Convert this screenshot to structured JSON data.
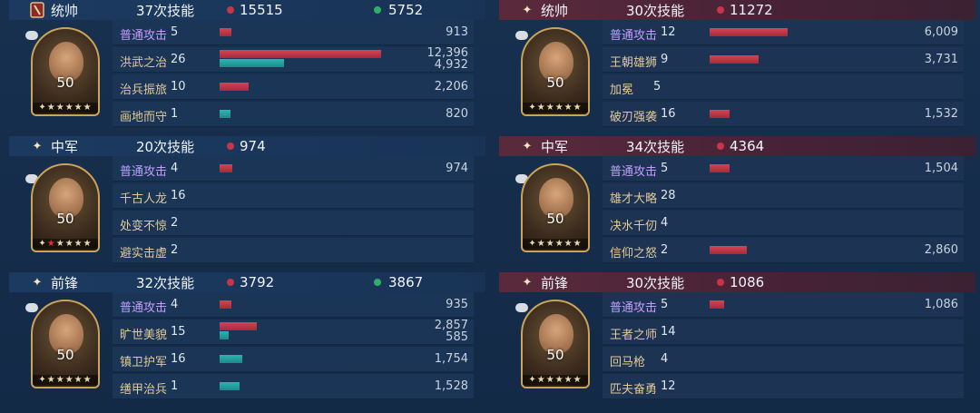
{
  "colors": {
    "accent_red": "#c8344a",
    "accent_green": "#2fae6a",
    "skill_gold": "#e2c99a",
    "skill_purple": "#c69cff"
  },
  "left": [
    {
      "role": "统帅",
      "count": "37次技能",
      "red": "15515",
      "green": "5752",
      "badge": "crest-icon",
      "level": "50",
      "stars": "✦★★★★★",
      "skills": [
        {
          "name": "普通攻击",
          "lv": "5",
          "basic": true,
          "bars": [
            {
              "c": "red",
              "v": 913
            }
          ],
          "vals": [
            "913"
          ]
        },
        {
          "name": "洪武之治",
          "lv": "26",
          "bars": [
            {
              "c": "red",
              "v": 12396
            },
            {
              "c": "teal",
              "v": 4932
            }
          ],
          "vals": [
            "12,396",
            "4,932"
          ]
        },
        {
          "name": "治兵振旅",
          "lv": "10",
          "bars": [
            {
              "c": "red",
              "v": 2206
            }
          ],
          "vals": [
            "2,206"
          ]
        },
        {
          "name": "画地而守",
          "lv": "1",
          "bars": [
            {
              "c": "teal",
              "v": 820
            }
          ],
          "vals": [
            "820"
          ]
        }
      ]
    },
    {
      "role": "中军",
      "count": "20次技能",
      "red": "974",
      "green": "",
      "badge": "✦",
      "level": "50",
      "stars": "✦",
      "stars_red": "★",
      "stars_tail": "★★★★",
      "skills": [
        {
          "name": "普通攻击",
          "lv": "4",
          "basic": true,
          "bars": [
            {
              "c": "red",
              "v": 974
            }
          ],
          "vals": [
            "974"
          ]
        },
        {
          "name": "千古人龙",
          "lv": "16",
          "bars": [],
          "vals": []
        },
        {
          "name": "处变不惊",
          "lv": "2",
          "bars": [],
          "vals": []
        },
        {
          "name": "避实击虚",
          "lv": "2",
          "bars": [],
          "vals": []
        }
      ]
    },
    {
      "role": "前锋",
      "count": "32次技能",
      "red": "3792",
      "green": "3867",
      "badge": "✦",
      "level": "50",
      "stars": "✦★★★★★",
      "skills": [
        {
          "name": "普通攻击",
          "lv": "4",
          "basic": true,
          "bars": [
            {
              "c": "red",
              "v": 935
            }
          ],
          "vals": [
            "935"
          ]
        },
        {
          "name": "旷世美貌",
          "lv": "15",
          "bars": [
            {
              "c": "red",
              "v": 2857
            },
            {
              "c": "teal",
              "v": 585
            }
          ],
          "vals": [
            "2,857",
            "585"
          ]
        },
        {
          "name": "镇卫护军",
          "lv": "16",
          "bars": [
            {
              "c": "teal",
              "v": 1754
            }
          ],
          "vals": [
            "1,754"
          ]
        },
        {
          "name": "缮甲治兵",
          "lv": "1",
          "bars": [
            {
              "c": "teal",
              "v": 1528
            }
          ],
          "vals": [
            "1,528"
          ]
        }
      ]
    }
  ],
  "right": [
    {
      "role": "统帅",
      "count": "30次技能",
      "red": "11272",
      "green": "",
      "badge": "✦",
      "level": "50",
      "stars": "✦★★★★★",
      "skills": [
        {
          "name": "普通攻击",
          "lv": "12",
          "basic": true,
          "bars": [
            {
              "c": "red",
              "v": 6009
            }
          ],
          "vals": [
            "6,009"
          ]
        },
        {
          "name": "王朝雄狮",
          "lv": "9",
          "bars": [
            {
              "c": "red",
              "v": 3731
            }
          ],
          "vals": [
            "3,731"
          ]
        },
        {
          "name": "加冕",
          "lv": "5",
          "bars": [],
          "vals": []
        },
        {
          "name": "破刃强袭",
          "lv": "16",
          "bars": [
            {
              "c": "red",
              "v": 1532
            }
          ],
          "vals": [
            "1,532"
          ]
        }
      ]
    },
    {
      "role": "中军",
      "count": "34次技能",
      "red": "4364",
      "green": "",
      "badge": "✦",
      "level": "50",
      "stars": "✦★★★★★",
      "skills": [
        {
          "name": "普通攻击",
          "lv": "5",
          "basic": true,
          "bars": [
            {
              "c": "red",
              "v": 1504
            }
          ],
          "vals": [
            "1,504"
          ]
        },
        {
          "name": "雄才大略",
          "lv": "28",
          "bars": [],
          "vals": []
        },
        {
          "name": "决水千仞",
          "lv": "4",
          "bars": [],
          "vals": []
        },
        {
          "name": "信仰之怒",
          "lv": "2",
          "bars": [
            {
              "c": "red",
              "v": 2860
            }
          ],
          "vals": [
            "2,860"
          ]
        }
      ]
    },
    {
      "role": "前锋",
      "count": "30次技能",
      "red": "1086",
      "green": "",
      "badge": "✦",
      "level": "50",
      "stars": "✦★★★★★",
      "skills": [
        {
          "name": "普通攻击",
          "lv": "5",
          "basic": true,
          "bars": [
            {
              "c": "red",
              "v": 1086
            }
          ],
          "vals": [
            "1,086"
          ]
        },
        {
          "name": "王者之师",
          "lv": "14",
          "bars": [],
          "vals": []
        },
        {
          "name": "回马枪",
          "lv": "4",
          "bars": [],
          "vals": []
        },
        {
          "name": "匹夫奋勇",
          "lv": "12",
          "bars": [],
          "vals": []
        }
      ]
    }
  ]
}
